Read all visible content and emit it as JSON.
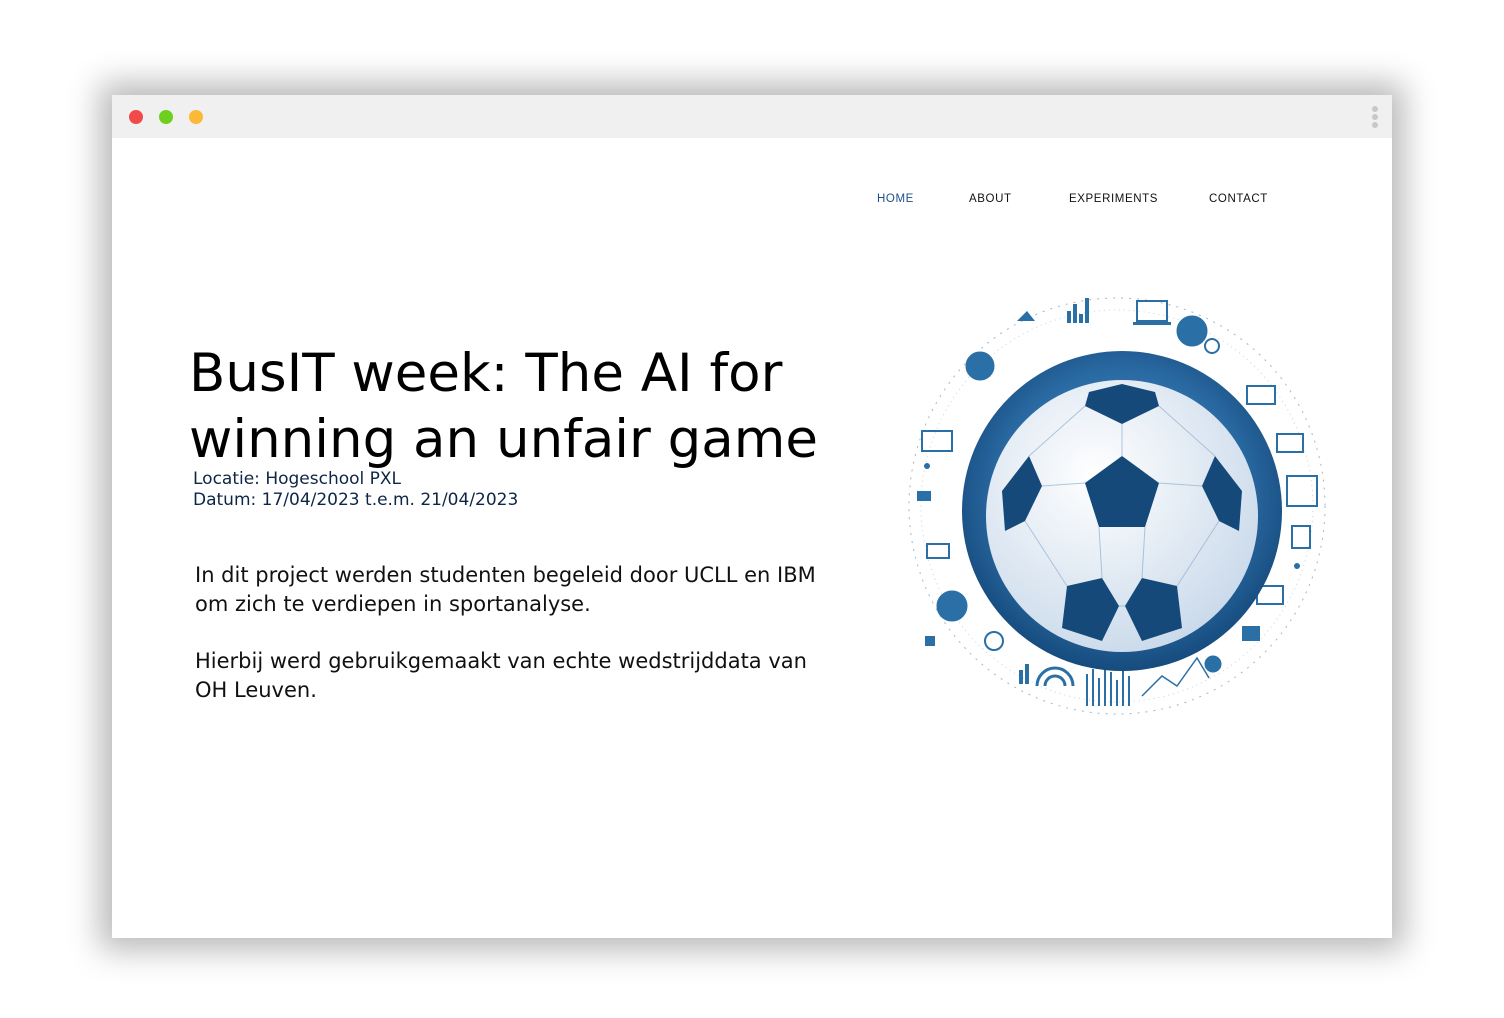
{
  "window": {
    "controls": [
      "close",
      "minimize",
      "maximize"
    ],
    "menu_icon": "kebab-menu-icon"
  },
  "nav": {
    "items": [
      {
        "label": "HOME",
        "active": true
      },
      {
        "label": "ABOUT",
        "active": false
      },
      {
        "label": "EXPERIMENTS",
        "active": false
      },
      {
        "label": "CONTACT",
        "active": false
      }
    ],
    "active_color": "#1f4f8a"
  },
  "hero": {
    "title": "BusIT week: The AI for winning an unfair game",
    "location": "Locatie: Hogeschool PXL",
    "date": "Datum: 17/04/2023 t.e.m. 21/04/2023",
    "paragraphs": [
      "In dit project werden studenten begeleid door UCLL en IBM om zich te verdiepen in sportanalyse.",
      "Hierbij werd gebruikgemaakt van echte wedstrijddata van OH Leuven."
    ]
  },
  "illustration": {
    "subject": "soccer-ball-with-data-icons",
    "accent_color": "#1f5c8f"
  }
}
